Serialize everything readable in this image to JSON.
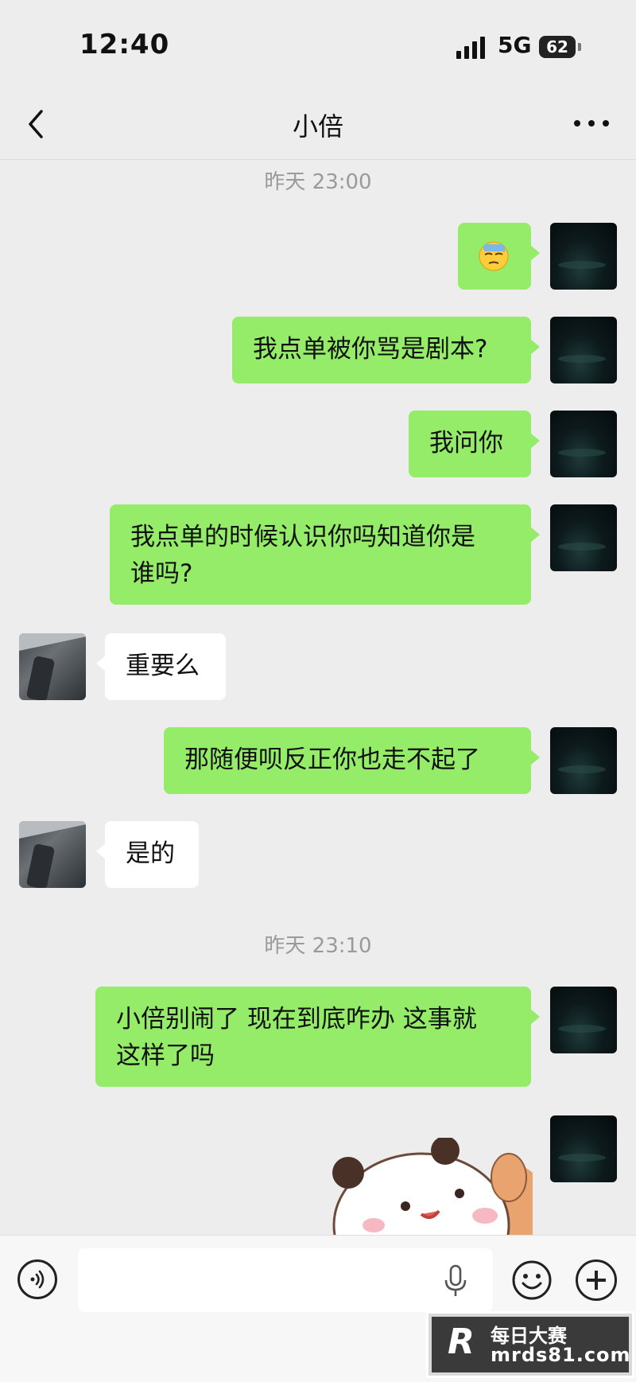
{
  "status_bar": {
    "time": "12:40",
    "network": "5G",
    "battery": "62"
  },
  "header": {
    "title": "小倍"
  },
  "conversation": {
    "timestamp_1": "昨天 23:00",
    "msg_emoji_name": "sweat-face-emoji",
    "msg_2": "我点单被你骂是剧本?",
    "msg_3": "我问你",
    "msg_4_line1": "我点单的时候认识你吗知道你是",
    "msg_4_line2": "谁吗?",
    "reply_1": "重要么",
    "msg_5": "那随便呗反正你也走不起了",
    "reply_2": "是的",
    "timestamp_2": "昨天 23:10",
    "msg_6_line1": "小倍别闹了 现在到底咋办 这事就",
    "msg_6_line2": "这样了吗",
    "msg_sticker_name": "panda-sticker"
  },
  "colors": {
    "sent_bubble": "#95ec69",
    "received_bubble": "#ffffff",
    "background": "#ededed"
  },
  "watermark": {
    "logo": "R",
    "text_1": "每日大赛",
    "text_2": "mrds81.com"
  }
}
